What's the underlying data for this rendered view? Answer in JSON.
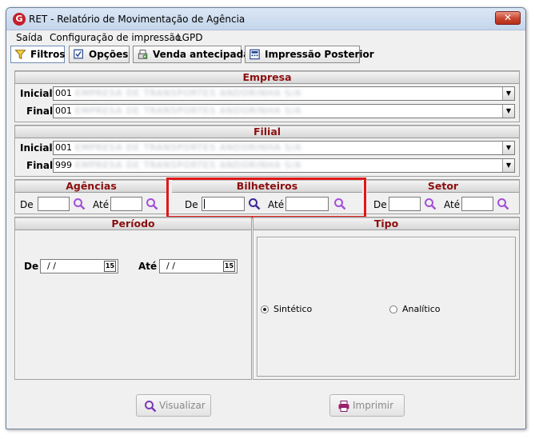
{
  "window": {
    "title": "RET - Relatório de Movimentação de Agência",
    "icon_letter": "G",
    "close_glyph": "✕"
  },
  "menu": [
    {
      "label": "Saída"
    },
    {
      "label": "Configuração de impressão"
    },
    {
      "label": "LGPD"
    }
  ],
  "tabs": [
    {
      "label": "Filtros"
    },
    {
      "label": "Opções"
    },
    {
      "label": "Venda antecipada"
    },
    {
      "label": "Impressão Posterior"
    }
  ],
  "empresa": {
    "title": "Empresa",
    "inicial_label": "Inicial",
    "final_label": "Final",
    "inicial_code": "001",
    "final_code": "001",
    "inicial_name": "EMPRESA DE TRANSPORTES ANDORINHA S/A",
    "final_name": "EMPRESA DE TRANSPORTES ANDORINHA S/A"
  },
  "filial": {
    "title": "Filial",
    "inicial_label": "Inicial",
    "final_label": "Final",
    "inicial_code": "001",
    "final_code": "999",
    "inicial_name": "EMPRESA DE TRANSPORTES ANDORINHA S/A",
    "final_name": "EMPRESA DE TRANSPORTES ANDORINHA S/A"
  },
  "agencias": {
    "title": "Agências",
    "de_label": "De",
    "ate_label": "Até"
  },
  "bilheteiros": {
    "title": "Bilheteiros",
    "de_label": "De",
    "ate_label": "Até"
  },
  "setor": {
    "title": "Setor",
    "de_label": "De",
    "ate_label": "Até"
  },
  "periodo": {
    "title": "Período",
    "de_label": "De",
    "ate_label": "Até",
    "de_value": "/ /",
    "ate_value": "/ /",
    "cal_glyph": "15"
  },
  "tipo": {
    "title": "Tipo",
    "options": [
      {
        "label": "Sintético",
        "selected": true
      },
      {
        "label": "Analítico",
        "selected": false
      }
    ]
  },
  "buttons": {
    "visualizar": "Visualizar",
    "imprimir": "Imprimir"
  },
  "colors": {
    "section_title": "#8b0f0f",
    "highlight": "#e01818",
    "title_bar": "#c4d6ec"
  }
}
